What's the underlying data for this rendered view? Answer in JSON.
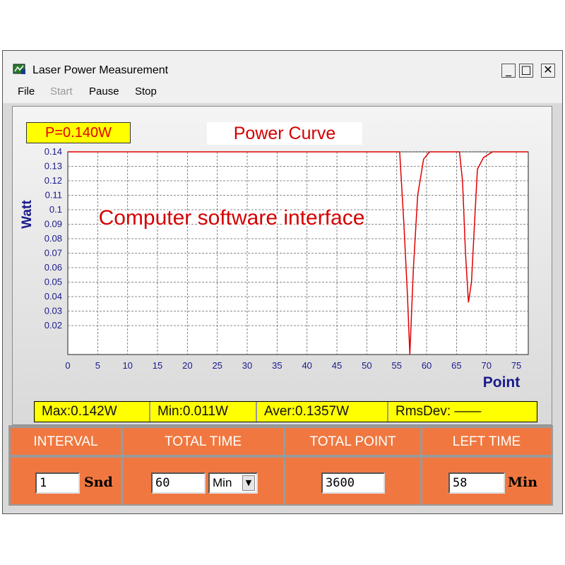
{
  "window": {
    "title": "Laser Power Measurement",
    "controls": {
      "minimize": "_",
      "maximize": "□",
      "close": "✕"
    }
  },
  "menu": {
    "file": "File",
    "start": "Start",
    "pause": "Pause",
    "stop": "Stop"
  },
  "power_readout": "P=0.140W",
  "overlay_text": "Computer software interface",
  "chart_data": {
    "type": "line",
    "title": "Power Curve",
    "xlabel": "Point",
    "ylabel": "Watt",
    "xlim": [
      0,
      77
    ],
    "ylim": [
      0,
      0.14
    ],
    "xticks": [
      0,
      5,
      10,
      15,
      20,
      25,
      30,
      35,
      40,
      45,
      50,
      55,
      60,
      65,
      70,
      75
    ],
    "yticks": [
      0.02,
      0.03,
      0.04,
      0.05,
      0.06,
      0.07,
      0.08,
      0.09,
      0.1,
      0.11,
      0.12,
      0.13,
      0.14
    ],
    "grid": true,
    "line_color": "#e00000",
    "series": [
      {
        "x": [
          0,
          10,
          10.5,
          11,
          25,
          26,
          27,
          30,
          55.5,
          56.2,
          56.8,
          57.2,
          57.8,
          58.5,
          59.5,
          60.5,
          65.5,
          66,
          66.5,
          67,
          67.5,
          68,
          68.5,
          69.5,
          71,
          77
        ],
        "y": [
          0.142,
          0.142,
          0.141,
          0.141,
          0.141,
          0.142,
          0.141,
          0.142,
          0.141,
          0.09,
          0.04,
          0.0,
          0.06,
          0.11,
          0.135,
          0.14,
          0.141,
          0.12,
          0.07,
          0.036,
          0.05,
          0.09,
          0.128,
          0.136,
          0.14,
          0.14
        ]
      }
    ]
  },
  "stats": {
    "max": "Max:0.142W",
    "min": "Min:0.011W",
    "aver": "Aver:0.1357W",
    "rmsdev": "RmsDev: ——"
  },
  "controls": {
    "interval": {
      "label": "INTERVAL",
      "value": "1",
      "unit": "Snd"
    },
    "total_time": {
      "label": "TOTAL TIME",
      "value": "60",
      "unit_selected": "Min"
    },
    "total_point": {
      "label": "TOTAL POINT",
      "value": "3600"
    },
    "left_time": {
      "label": "LEFT TIME",
      "value": "58",
      "unit": "Min"
    }
  },
  "colors": {
    "accent": "#f07840",
    "readout_bg": "#ffff00",
    "curve": "#e00000",
    "axis_text": "#1a1a8c"
  }
}
